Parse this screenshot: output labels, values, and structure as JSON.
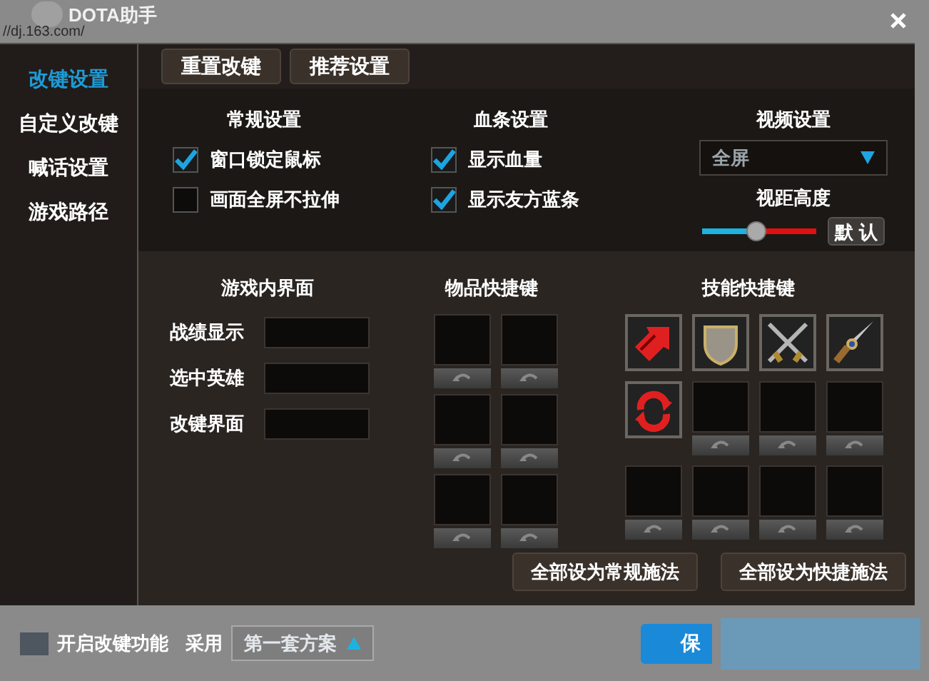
{
  "window": {
    "logo": "DOTA助手",
    "address": "//dj.163.com/"
  },
  "sidebar": [
    {
      "label": "改键设置",
      "selected": true
    },
    {
      "label": "自定义改键",
      "selected": false
    },
    {
      "label": "喊话设置",
      "selected": false
    },
    {
      "label": "游戏路径",
      "selected": false
    }
  ],
  "toolbar": [
    "重置改键",
    "推荐设置"
  ],
  "general": {
    "title": "常规设置",
    "options": [
      {
        "label": "窗口锁定鼠标",
        "checked": true
      },
      {
        "label": "画面全屏不拉伸",
        "checked": false
      }
    ]
  },
  "health_bar": {
    "title": "血条设置",
    "options": [
      {
        "label": "显示血量",
        "checked": true
      },
      {
        "label": "显示友方蓝条",
        "checked": true
      }
    ]
  },
  "video": {
    "title": "视频设置",
    "mode": "全屏",
    "distance_label": "视距高度",
    "level": 0.47,
    "default_button": "默 认"
  },
  "ingame": {
    "title": "游戏内界面",
    "fields": [
      {
        "label": "战绩显示"
      },
      {
        "label": "选中英雄"
      },
      {
        "label": "改键界面"
      }
    ]
  },
  "items": {
    "title": "物品快捷键",
    "slots": [
      {
        "kind": "empty"
      },
      {
        "kind": "empty"
      },
      {
        "kind": "empty"
      },
      {
        "kind": "empty"
      },
      {
        "kind": "empty"
      },
      {
        "kind": "empty"
      }
    ]
  },
  "skills": {
    "title": "技能快捷键",
    "slots": [
      {
        "kind": "filled"
      },
      {
        "kind": "filled"
      },
      {
        "kind": "filled"
      },
      {
        "kind": "filled"
      },
      {
        "kind": "filled"
      },
      {
        "kind": "empty"
      },
      {
        "kind": "empty"
      },
      {
        "kind": "empty"
      },
      {
        "kind": "empty"
      },
      {
        "kind": "empty"
      },
      {
        "kind": "empty"
      },
      {
        "kind": "empty"
      }
    ]
  },
  "skill_buttons": [
    "全部设为常规施法",
    "全部设为快捷施法"
  ],
  "footer": {
    "enable_label": "开启改键功能",
    "use_label": "采用",
    "scheme": "第一套方案",
    "save": "保"
  }
}
